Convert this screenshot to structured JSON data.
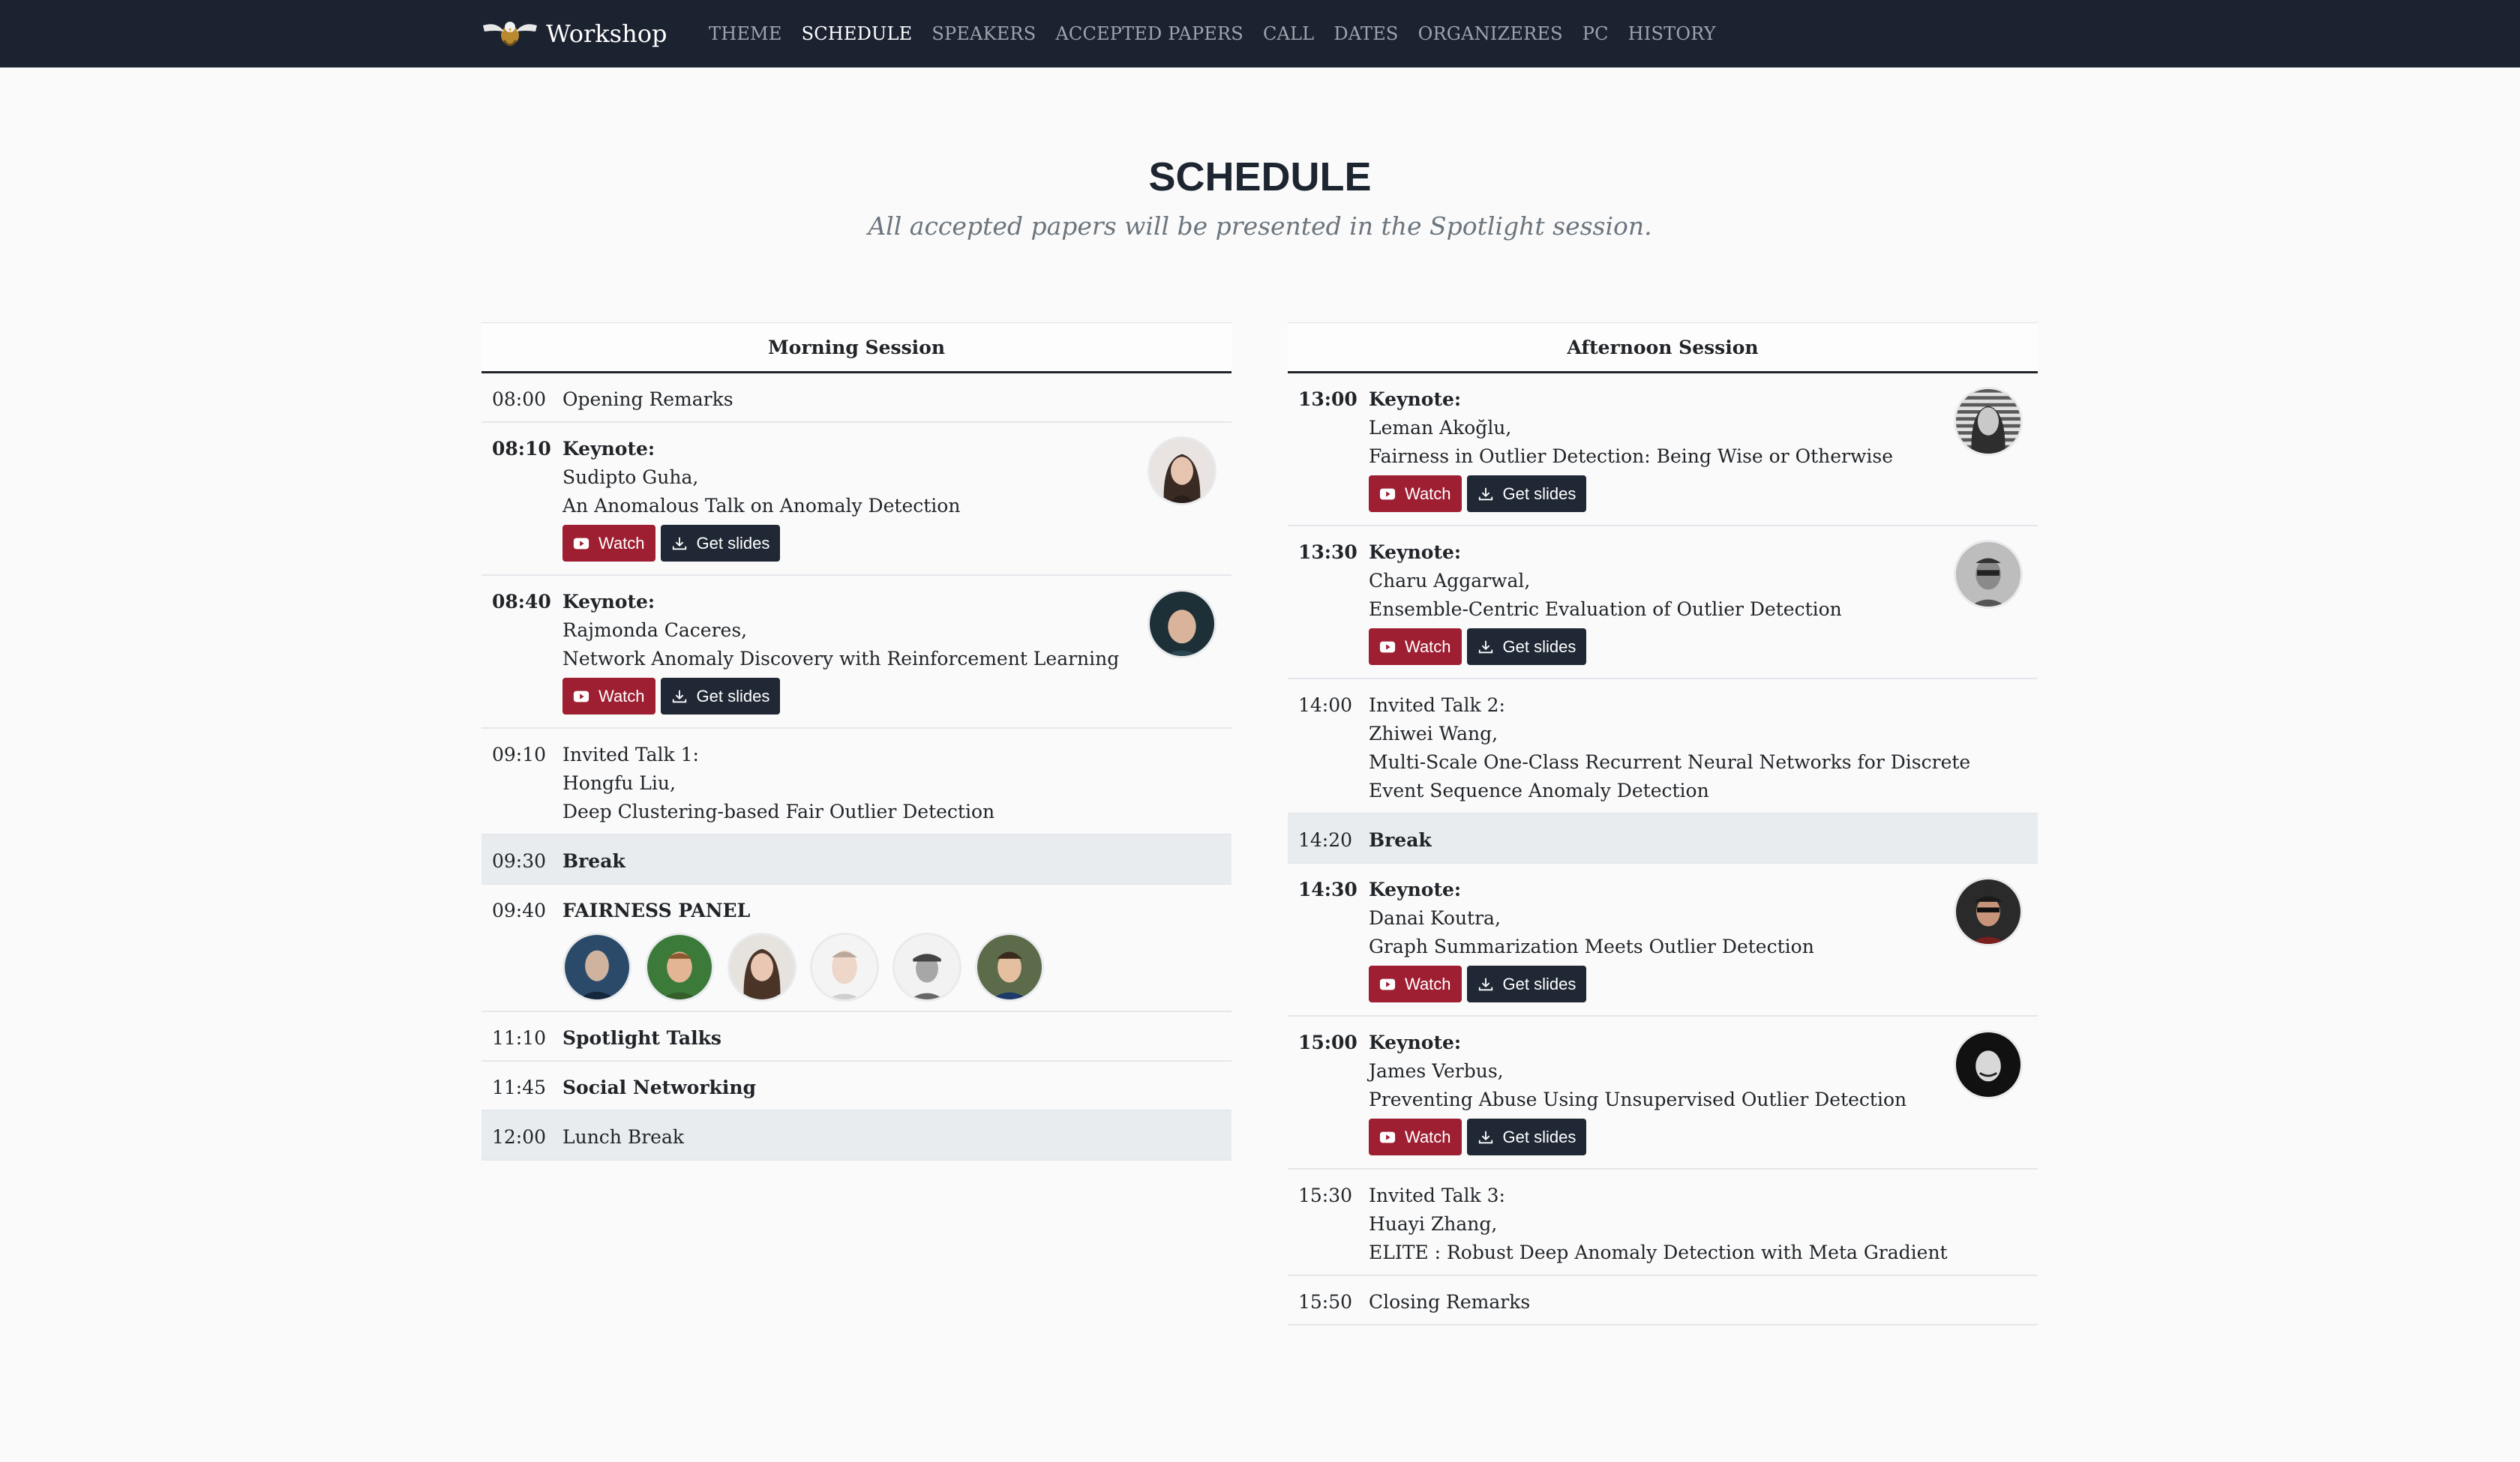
{
  "navbar": {
    "brand": "Workshop",
    "links": [
      "THEME",
      "SCHEDULE",
      "SPEAKERS",
      "ACCEPTED PAPERS",
      "CALL",
      "DATES",
      "ORGANIZERES",
      "PC",
      "HISTORY"
    ],
    "active": "SCHEDULE"
  },
  "page": {
    "title": "SCHEDULE",
    "subtitle": "All accepted papers will be presented in the Spotlight session."
  },
  "buttons": {
    "watch": "Watch",
    "slides": "Get slides"
  },
  "morning": {
    "header": "Morning Session",
    "rows": [
      {
        "time": "08:00",
        "title": "Opening Remarks"
      },
      {
        "time": "08:10",
        "kind": "Keynote:",
        "speaker": "Sudipto Guha,",
        "talk": "An Anomalous Talk on Anomaly Detection"
      },
      {
        "time": "08:40",
        "kind": "Keynote:",
        "speaker": "Rajmonda Caceres,",
        "talk": "Network Anomaly Discovery with Reinforcement Learning"
      },
      {
        "time": "09:10",
        "kind": "Invited Talk 1:",
        "speaker": "Hongfu Liu,",
        "talk": "Deep Clustering-based Fair Outlier Detection"
      },
      {
        "time": "09:30",
        "title": "Break"
      },
      {
        "time": "09:40",
        "title": "FAIRNESS PANEL"
      },
      {
        "time": "11:10",
        "title": "Spotlight Talks"
      },
      {
        "time": "11:45",
        "title": "Social Networking"
      },
      {
        "time": "12:00",
        "title": "Lunch Break"
      }
    ]
  },
  "afternoon": {
    "header": "Afternoon Session",
    "rows": [
      {
        "time": "13:00",
        "kind": "Keynote:",
        "speaker": "Leman Akoğlu,",
        "talk": "Fairness in Outlier Detection: Being Wise or Otherwise"
      },
      {
        "time": "13:30",
        "kind": "Keynote:",
        "speaker": "Charu Aggarwal,",
        "talk": "Ensemble-Centric Evaluation of Outlier Detection"
      },
      {
        "time": "14:00",
        "kind": "Invited Talk 2:",
        "speaker": "Zhiwei Wang,",
        "talk": "Multi-Scale One-Class Recurrent Neural Networks for Discrete Event Sequence Anomaly Detection"
      },
      {
        "time": "14:20",
        "title": "Break"
      },
      {
        "time": "14:30",
        "kind": "Keynote:",
        "speaker": "Danai Koutra,",
        "talk": "Graph Summarization Meets Outlier Detection"
      },
      {
        "time": "15:00",
        "kind": "Keynote:",
        "speaker": "James Verbus,",
        "talk": "Preventing Abuse Using Unsupervised Outlier Detection"
      },
      {
        "time": "15:30",
        "kind": "Invited Talk 3:",
        "speaker": "Huayi Zhang,",
        "talk": "ELITE : Robust Deep Anomaly Detection with Meta Gradient"
      },
      {
        "time": "15:50",
        "title": "Closing Remarks"
      }
    ]
  },
  "colors": {
    "navbar": "#1b2331",
    "watch": "#9e1f32",
    "slides": "#1f2834",
    "break_row": "#e9ecef"
  },
  "icons": {
    "brand": "eagle-logo-icon",
    "watch": "youtube-play-icon",
    "slides": "download-icon"
  }
}
